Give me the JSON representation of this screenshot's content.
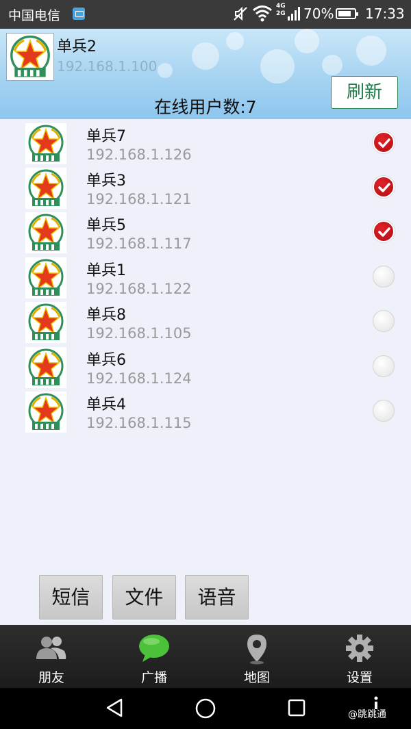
{
  "status_bar": {
    "carrier": "中国电信",
    "network": "4G",
    "network2": "2G",
    "battery": "70%",
    "time": "17:33"
  },
  "header": {
    "me_name": "单兵2",
    "me_ip": "192.168.1.100",
    "refresh_label": "刷新",
    "online_count": "在线用户数:7"
  },
  "users": [
    {
      "name": "单兵7",
      "ip": "192.168.1.126",
      "checked": true
    },
    {
      "name": "单兵3",
      "ip": "192.168.1.121",
      "checked": true
    },
    {
      "name": "单兵5",
      "ip": "192.168.1.117",
      "checked": true
    },
    {
      "name": "单兵1",
      "ip": "192.168.1.122",
      "checked": false
    },
    {
      "name": "单兵8",
      "ip": "192.168.1.105",
      "checked": false
    },
    {
      "name": "单兵6",
      "ip": "192.168.1.124",
      "checked": false
    },
    {
      "name": "单兵4",
      "ip": "192.168.1.115",
      "checked": false
    }
  ],
  "actions": {
    "sms": "短信",
    "file": "文件",
    "voice": "语音"
  },
  "tabs": [
    {
      "label": "朋友",
      "icon": "friends-icon"
    },
    {
      "label": "广播",
      "icon": "chat-bubble-icon"
    },
    {
      "label": "地图",
      "icon": "map-pin-icon"
    },
    {
      "label": "设置",
      "icon": "gear-icon"
    }
  ],
  "watermark": "@跳跳通",
  "colors": {
    "header_top": "#c9e6f8",
    "header_bottom": "#8ec6ee",
    "check_on": "#d8141c",
    "refresh_text": "#1f7a49",
    "broadcast_icon": "#4cc23a"
  }
}
